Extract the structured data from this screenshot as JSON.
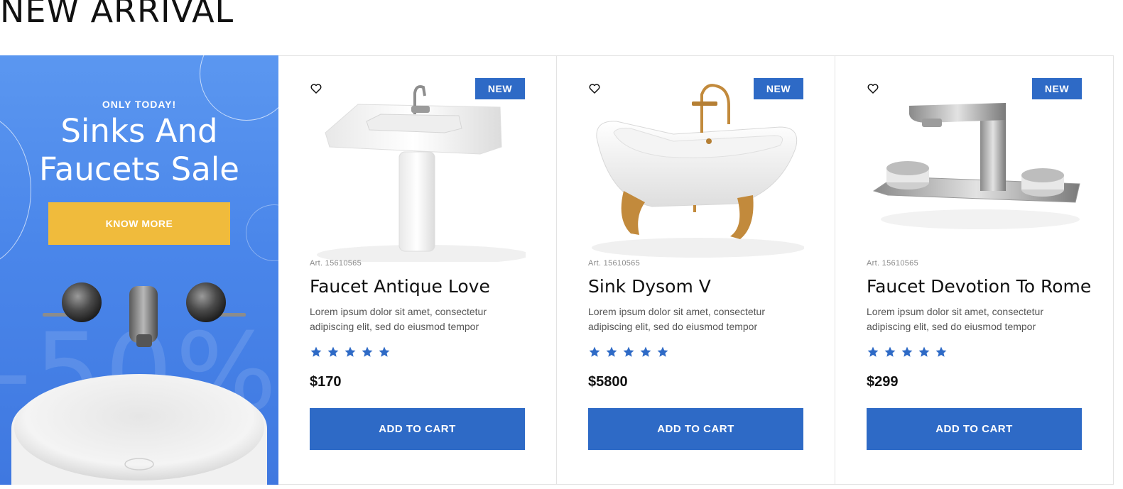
{
  "section": {
    "title": "NEW ARRIVAL"
  },
  "promo": {
    "eyebrow": "ONLY TODAY!",
    "headline_line1": "Sinks And",
    "headline_line2": "Faucets Sale",
    "button_label": "KNOW MORE",
    "discount_text": "-50%",
    "colors": {
      "background": "#4a86ea",
      "button": "#f0bb3c"
    }
  },
  "products": [
    {
      "badge": "NEW",
      "art": "Art. 15610565",
      "name": "Faucet Antique Love",
      "description": "Lorem ipsum dolor sit amet, consectetur adipiscing elit, sed do eiusmod tempor",
      "rating": 5,
      "price": "$170",
      "cart_label": "ADD TO CART",
      "image": "pedestal-sink-image"
    },
    {
      "badge": "NEW",
      "art": "Art. 15610565",
      "name": "Sink Dysom V",
      "description": "Lorem ipsum dolor sit amet, consectetur adipiscing elit, sed do eiusmod tempor",
      "rating": 5,
      "price": "$5800",
      "cart_label": "ADD TO CART",
      "image": "clawfoot-bathtub-image"
    },
    {
      "badge": "NEW",
      "art": "Art. 15610565",
      "name": "Faucet Devotion To Rome",
      "description": "Lorem ipsum dolor sit amet, consectetur adipiscing elit, sed do eiusmod tempor",
      "rating": 5,
      "price": "$299",
      "cart_label": "ADD TO CART",
      "image": "deck-faucet-image"
    }
  ],
  "icons": {
    "wishlist": "heart-icon",
    "rating": "star-icon"
  },
  "colors": {
    "accent": "#2e6ac6",
    "text": "#111111",
    "muted": "#8a8a8a"
  }
}
